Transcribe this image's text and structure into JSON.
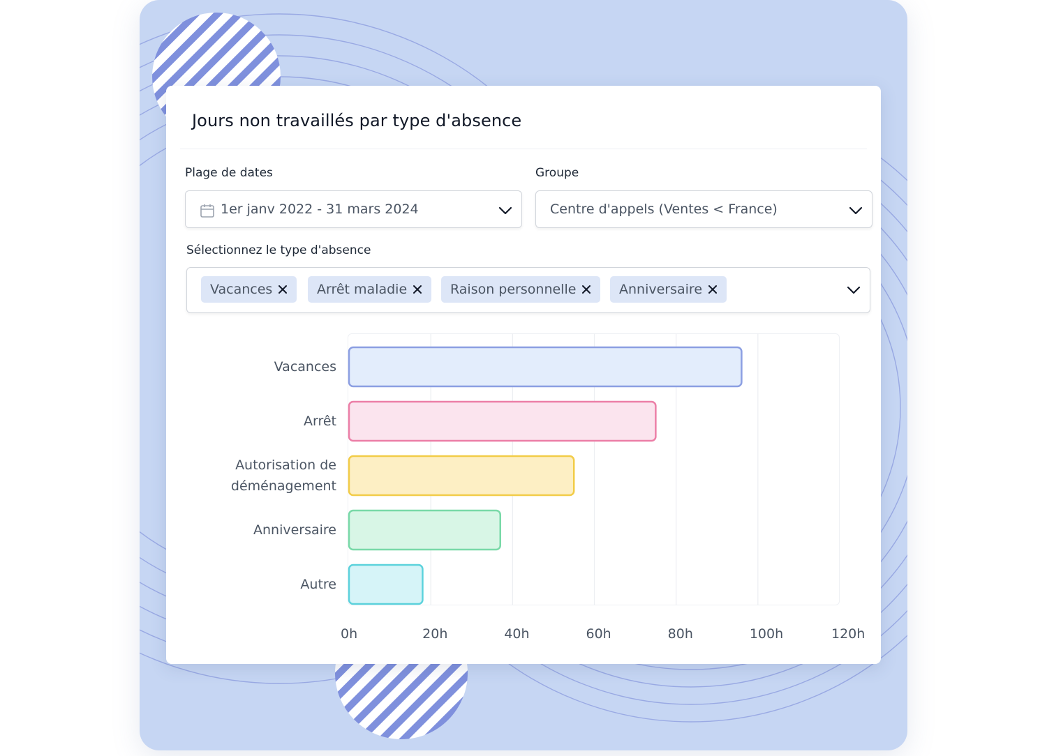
{
  "card": {
    "title": "Jours non travaillés par type d'absence"
  },
  "filters": {
    "date_range": {
      "label": "Plage de dates",
      "value": "1er janv 2022 - 31 mars 2024"
    },
    "group": {
      "label": "Groupe",
      "value": "Centre d'appels (Ventes < France)"
    },
    "absence_type": {
      "label": "Sélectionnez le type d'absence",
      "chips": [
        "Vacances",
        "Arrêt maladie",
        "Raison personnelle",
        "Anniversaire"
      ]
    }
  },
  "chart_data": {
    "type": "bar",
    "orientation": "horizontal",
    "categories": [
      "Vacances",
      "Arrêt",
      "Autorisation de déménagement",
      "Anniversaire",
      "Autre"
    ],
    "category_lines": [
      [
        "Vacances"
      ],
      [
        "Arrêt"
      ],
      [
        "Autorisation de",
        "déménagement"
      ],
      [
        "Anniversaire"
      ],
      [
        "Autre"
      ]
    ],
    "values": [
      96,
      75,
      55,
      37,
      18
    ],
    "x_unit": "h",
    "xlim": [
      0,
      120
    ],
    "xticks": [
      "0h",
      "20h",
      "40h",
      "60h",
      "80h",
      "100h",
      "120h"
    ],
    "grid": true,
    "colors": [
      {
        "fill": "#e3edfc",
        "stroke": "#8c9fe2"
      },
      {
        "fill": "#fbe4ee",
        "stroke": "#ec7fa7"
      },
      {
        "fill": "#fdefc4",
        "stroke": "#f2cc48"
      },
      {
        "fill": "#d8f6e6",
        "stroke": "#79d9a8"
      },
      {
        "fill": "#d6f4f8",
        "stroke": "#5cd2dc"
      }
    ]
  },
  "icons": {
    "calendar": "calendar-icon",
    "chevron": "chevron-down-icon",
    "remove": "close-icon"
  }
}
